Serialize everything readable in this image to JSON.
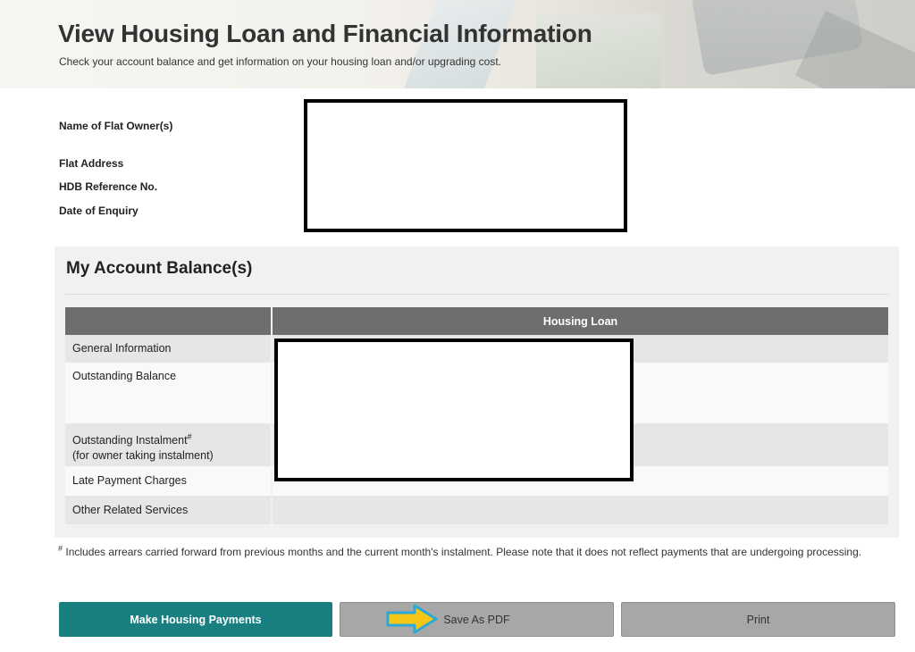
{
  "header": {
    "title": "View Housing Loan and Financial Information",
    "subtitle": "Check your account balance and get information on your housing loan and/or upgrading cost."
  },
  "owner_info": {
    "labels": [
      "Name of Flat Owner(s)",
      "Flat Address",
      "HDB Reference No.",
      "Date of Enquiry"
    ]
  },
  "account_balance": {
    "title": "My Account Balance(s)",
    "columns": [
      "",
      "Housing Loan"
    ],
    "rows": [
      {
        "label": "General Information",
        "value": ""
      },
      {
        "label": "Outstanding Balance",
        "value": ""
      },
      {
        "label": "Outstanding Instalment",
        "label_sup": "#",
        "label_sub": "(for owner taking instalment)",
        "value": ""
      },
      {
        "label": "Late Payment Charges",
        "value": "-"
      },
      {
        "label": "Other Related Services",
        "value": ""
      }
    ],
    "footnote_mark": "#",
    "footnote": "Includes arrears carried forward from previous months and the current month's instalment. Please note that it does not reflect payments that are undergoing processing."
  },
  "actions": {
    "make_payment": "Make Housing Payments",
    "save_pdf": "Save As PDF",
    "print": "Print"
  },
  "colors": {
    "primary_button": "#1a7f80",
    "table_header": "#6e6e6e",
    "highlight_arrow": "#f5c518",
    "arrow_outline": "#2aa9d6"
  },
  "icons": {
    "pointer": "arrow-right-icon"
  }
}
